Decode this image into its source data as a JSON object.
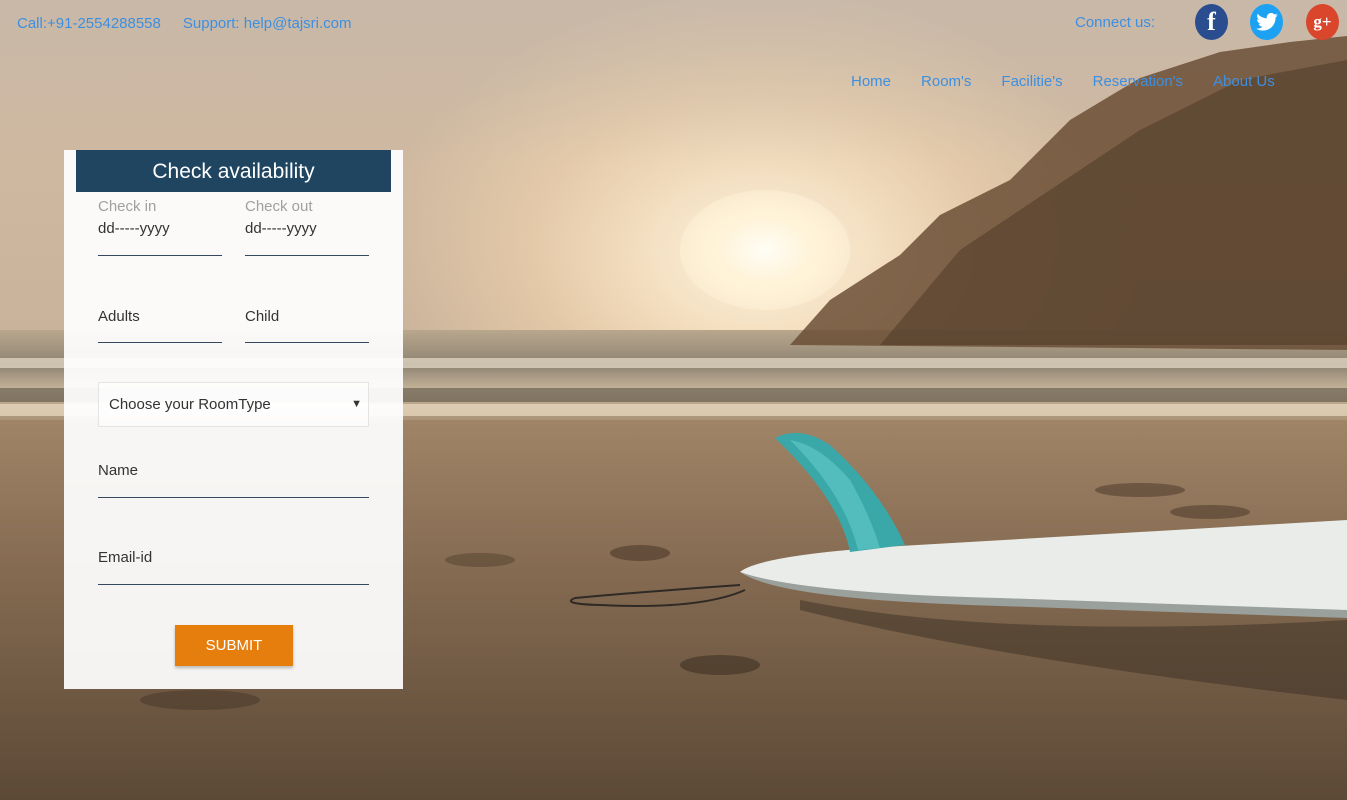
{
  "topbar": {
    "call": "Call:+91-2554288558",
    "support": "Support: help@tajsri.com",
    "connect_label": "Connect us:",
    "social": [
      {
        "icon": "facebook-icon",
        "glyph": "f",
        "color": "#2a4d8f"
      },
      {
        "icon": "twitter-icon",
        "color": "#1da1f2"
      },
      {
        "icon": "google-plus-icon",
        "glyph": "g+",
        "color": "#d9462b"
      }
    ]
  },
  "nav": {
    "items": [
      "Home",
      "Room's",
      "Facilitie's",
      "Reservation's",
      "About Us"
    ]
  },
  "form": {
    "title": "Check availability",
    "check_in_label": "Check in",
    "check_in_value": "dd-----yyyy",
    "check_out_label": "Check out",
    "check_out_value": "dd-----yyyy",
    "adults_placeholder": "Adults",
    "child_placeholder": "Child",
    "room_type_selected": "Choose your RoomType",
    "name_placeholder": "Name",
    "email_placeholder": "Email-id",
    "submit_label": "SUBMIT"
  },
  "colors": {
    "link": "#3d8fe0",
    "header_bg": "#1f4560",
    "submit_bg": "#e67e0e"
  }
}
